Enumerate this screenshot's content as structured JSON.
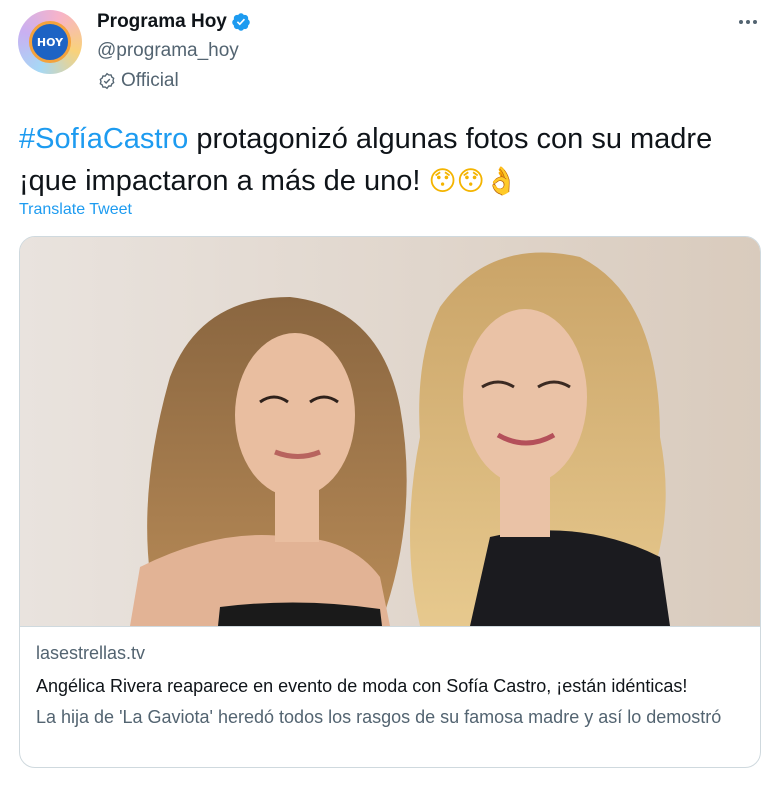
{
  "author": {
    "display_name": "Programa Hoy",
    "handle": "@programa_hoy",
    "official_label": "Official",
    "avatar_text": "HOY"
  },
  "icons": {
    "verified": "verified-badge-icon",
    "official": "official-check-icon",
    "more": "more-options-icon"
  },
  "tweet": {
    "hashtag": "#SofíaCastro",
    "text_line1": " protagonizó algunas fotos con su madre",
    "text_line2": "¡que impactaron a más de uno! ",
    "emojis": "😯😯👌",
    "translate_label": "Translate Tweet"
  },
  "card": {
    "domain": "lasestrellas.tv",
    "title": "Angélica Rivera reaparece en evento de moda con Sofía Castro, ¡están idénticas!",
    "description": "La hija de 'La Gaviota' heredó todos los rasgos de su famosa madre y así lo demostró"
  },
  "colors": {
    "link": "#1d9bf0",
    "text": "#0f1419",
    "secondary": "#536471",
    "border": "#cfd9de"
  }
}
